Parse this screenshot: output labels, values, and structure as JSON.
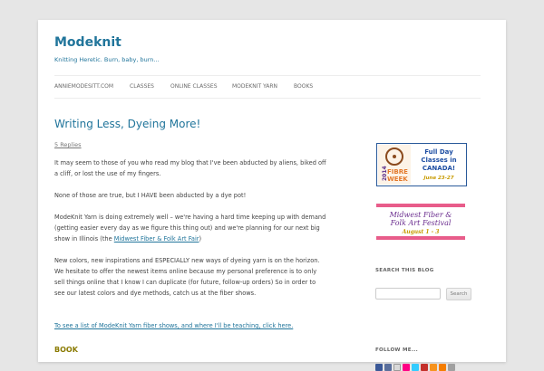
{
  "header": {
    "site_title": "Modeknit",
    "tagline": "Knitting Heretic. Burn, baby, burn..."
  },
  "nav": {
    "items": [
      {
        "label": "ANNIEMODESITT.COM"
      },
      {
        "label": "CLASSES"
      },
      {
        "label": "ONLINE CLASSES"
      },
      {
        "label": "MODEKNIT YARN"
      },
      {
        "label": "BOOKS"
      }
    ]
  },
  "post": {
    "title": "Writing Less, Dyeing More!",
    "replies": "5 Replies",
    "p1": "It may seem to those of you who read my blog that I've been abducted by aliens, biked off a cliff, or lost the use of my fingers.",
    "p2": "None of those are true, but I HAVE been abducted by a dye pot!",
    "p3_pre": "ModeKnit Yarn is doing extremely well – we're having a hard time keeping up with demand (getting easier every day as we figure this thing out) and we're planning for our next big show in Illinois (the ",
    "p3_link": "Midwest Fiber & Folk Art Fair",
    "p3_post": ")",
    "p4": "New colors, new inspirations and ESPECIALLY new ways of dyeing yarn is on the horizon. We hesitate to offer the newest items online because my personal preference is to only sell things online that I know I can duplicate (for future, follow-up orders)  So in order to see our latest colors and dye methods, catch us at the fiber shows.",
    "link_text": "To see a list of ModeKnit Yarn fiber shows, and where I'll be teaching, click here.",
    "book_heading": "BOOK"
  },
  "sidebar": {
    "ad1": {
      "year": "2014",
      "brand_line1": "FIBRE",
      "brand_line2": "WEEK",
      "line1": "Full Day",
      "line2": "Classes in",
      "line3": "CANADA!",
      "dates": "June 23-27"
    },
    "ad2": {
      "line1": "Midwest Fiber &",
      "line2": "Folk Art Festival",
      "dates": "August 1 - 3"
    },
    "search_title": "SEARCH THIS BLOG",
    "search_placeholder": "",
    "search_button": "Search",
    "follow_title": "FOLLOW ME...",
    "follow_icons": [
      "facebook-icon",
      "myspace-icon",
      "email-icon",
      "flickr-icon",
      "twitter-icon",
      "youtube-icon",
      "rss-icon",
      "blogger-icon",
      "etsy-icon"
    ],
    "colors": {
      "brand_blue": "#21759b",
      "ad_text_blue": "#1f4fa3",
      "ad_dates_gold": "#c79a00",
      "fibre_orange": "#e3792b",
      "festival_purple": "#6a2c8e"
    }
  }
}
